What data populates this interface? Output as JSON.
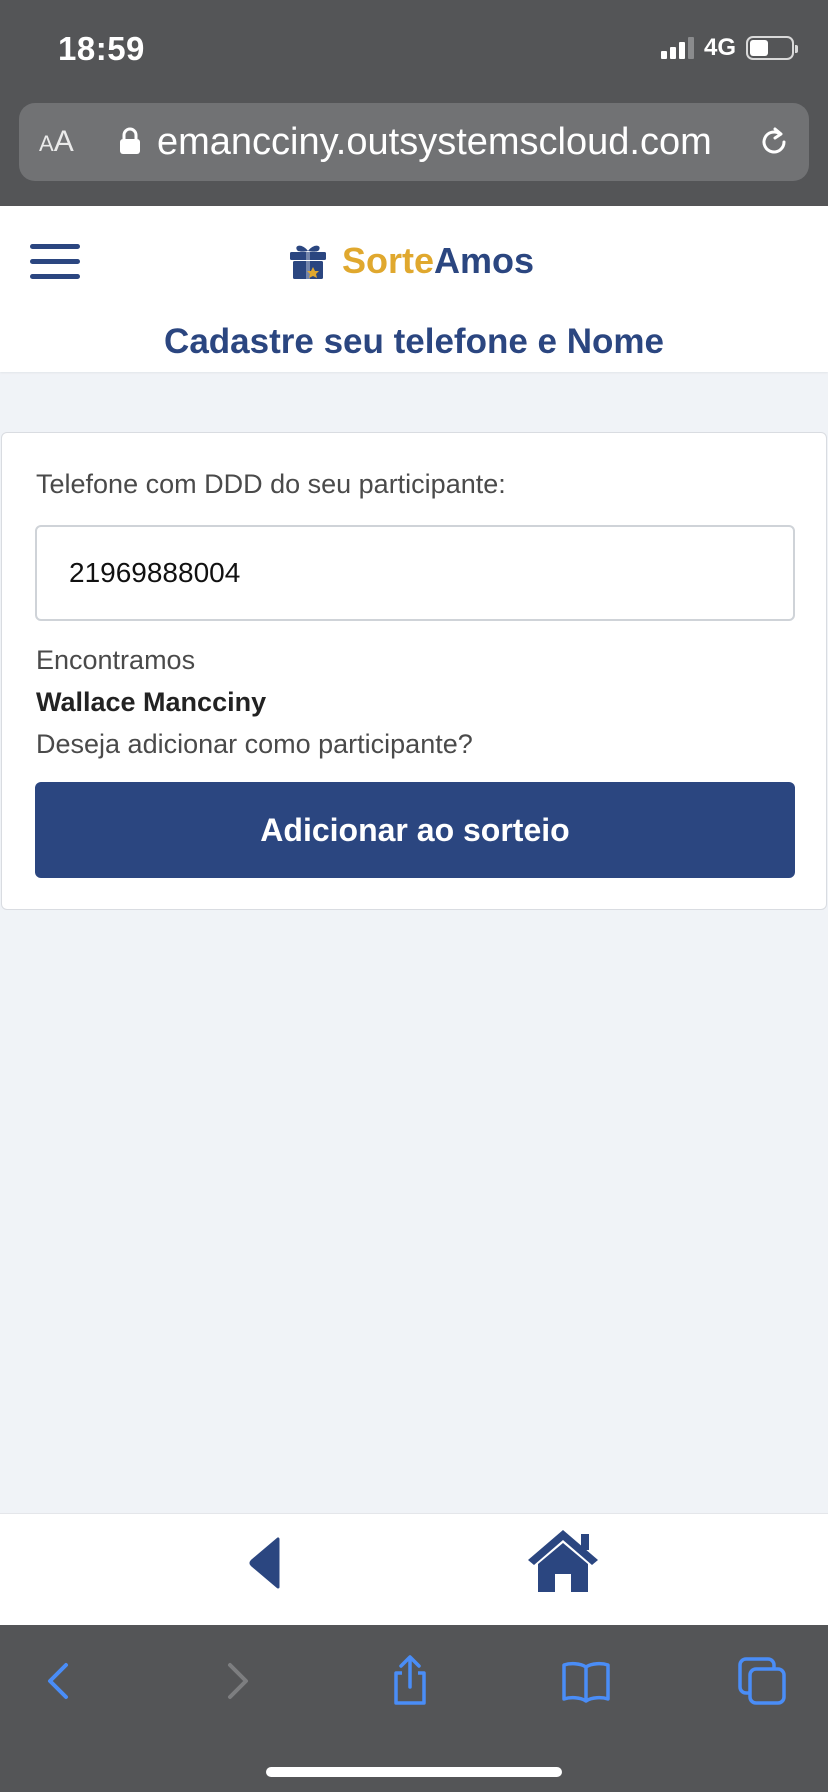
{
  "status_bar": {
    "time": "18:59",
    "network": "4G"
  },
  "browser": {
    "aa_label_small": "A",
    "aa_label_large": "A",
    "url": "emancciny.outsystemscloud.com"
  },
  "header": {
    "brand_part1": "Sorte",
    "brand_part2": "Amos",
    "title": "Cadastre seu telefone e Nome"
  },
  "form": {
    "phone_label": "Telefone com DDD do seu participante:",
    "phone_value": "21969888004",
    "found_text": "Encontramos",
    "participant_name": "Wallace Mancciny",
    "question": "Deseja adicionar como participante?",
    "add_button": "Adicionar ao sorteio"
  },
  "icons": {
    "menu": "hamburger-icon",
    "brand": "gift-icon",
    "back": "triangle-left-icon",
    "home": "home-icon",
    "safari_back": "chevron-left-icon",
    "safari_forward": "chevron-right-icon",
    "share": "share-icon",
    "bookmarks": "book-icon",
    "tabs": "tabs-icon"
  },
  "colors": {
    "primary": "#2b4680",
    "accent": "#e0a82e",
    "page_background": "#f0f3f7",
    "browser_chrome": "#545557"
  }
}
